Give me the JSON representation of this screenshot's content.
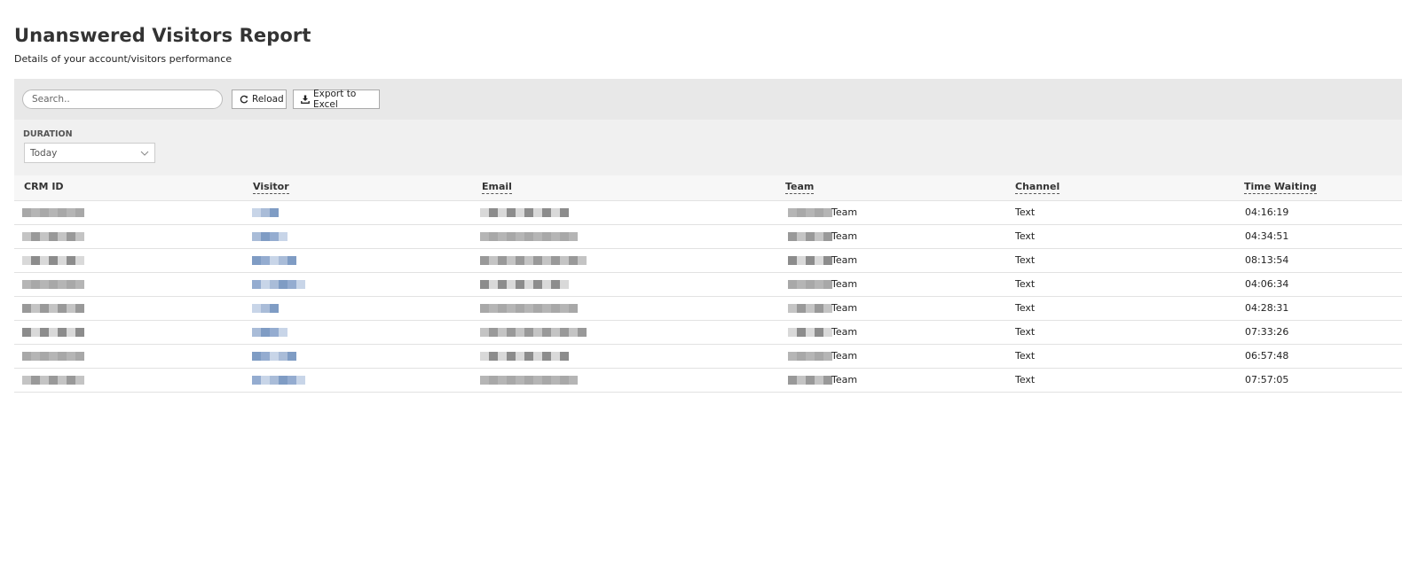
{
  "page": {
    "title": "Unanswered Visitors Report",
    "subtitle": "Details of your account/visitors performance"
  },
  "toolbar": {
    "search_placeholder": "Search..",
    "reload_label": "Reload",
    "export_label": "Export to Excel"
  },
  "filters": {
    "duration_label": "DURATION",
    "duration_value": "Today"
  },
  "table": {
    "headers": {
      "crm_id": "CRM ID",
      "visitor": "Visitor",
      "email": "Email",
      "team": "Team",
      "channel": "Channel",
      "time_waiting": "Time Waiting"
    },
    "rows": [
      {
        "team": "Team",
        "channel": "Text",
        "time_waiting": "04:16:19"
      },
      {
        "team": "Team",
        "channel": "Text",
        "time_waiting": "04:34:51"
      },
      {
        "team": "Team",
        "channel": "Text",
        "time_waiting": "08:13:54"
      },
      {
        "team": "Team",
        "channel": "Text",
        "time_waiting": "04:06:34"
      },
      {
        "team": "Team",
        "channel": "Text",
        "time_waiting": "04:28:31"
      },
      {
        "team": "Team",
        "channel": "Text",
        "time_waiting": "07:33:26"
      },
      {
        "team": "Team",
        "channel": "Text",
        "time_waiting": "06:57:48"
      },
      {
        "team": "Team",
        "channel": "Text",
        "time_waiting": "07:57:05"
      }
    ]
  },
  "icons": {
    "reload": "reload-icon",
    "export": "download-icon",
    "dropdown": "chevron-down-icon"
  },
  "colors": {
    "toolbar_bg": "#e8e8e8",
    "filter_bg": "#f0f0f0",
    "visitor_blur": "#7f9cc4",
    "gray_blur": "#9a9a9a"
  }
}
